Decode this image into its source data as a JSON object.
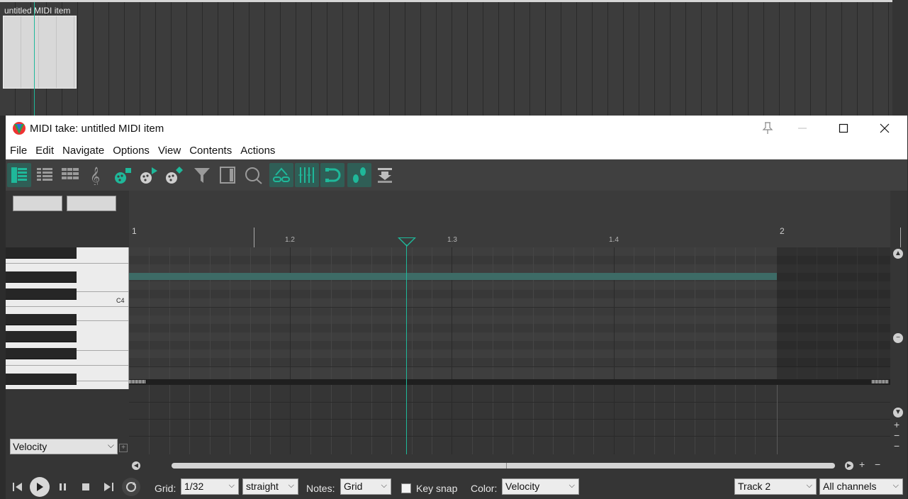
{
  "arrange": {
    "item_label": "untitled MIDI item"
  },
  "window": {
    "title": "MIDI take: untitled MIDI item",
    "controls": {
      "pin": "📌",
      "minimize": "—",
      "maximize": "☐",
      "close": "✕"
    }
  },
  "menu": [
    "File",
    "Edit",
    "Navigate",
    "Options",
    "View",
    "Contents",
    "Actions"
  ],
  "ruler": {
    "bar1": "1",
    "beat2": "1.2",
    "beat3": "1.3",
    "beat4": "1.4",
    "bar2": "2"
  },
  "keyboard": {
    "c4_label": "C4"
  },
  "lane": {
    "selected": "Velocity"
  },
  "bottom": {
    "grid_label": "Grid:",
    "grid_value": "1/32",
    "swing_value": "straight",
    "notes_label": "Notes:",
    "notes_value": "Grid",
    "keysnap_label": "Key snap",
    "color_label": "Color:",
    "color_value": "Velocity",
    "track_value": "Track 2",
    "channel_value": "All channels"
  },
  "colors": {
    "accent": "#1fb89a",
    "active_tool_bg": "#2f5e56"
  },
  "icons": [
    "piano-roll-icon",
    "named-notes-icon",
    "drum-grid-icon",
    "notation-icon",
    "insert-note-icon",
    "insert-note-arrow-icon",
    "insert-note-diamond-icon",
    "filter-icon",
    "event-list-icon",
    "quantize-icon",
    "link-icon",
    "grid-icon",
    "snap-icon",
    "step-input-icon",
    "media-download-icon"
  ]
}
